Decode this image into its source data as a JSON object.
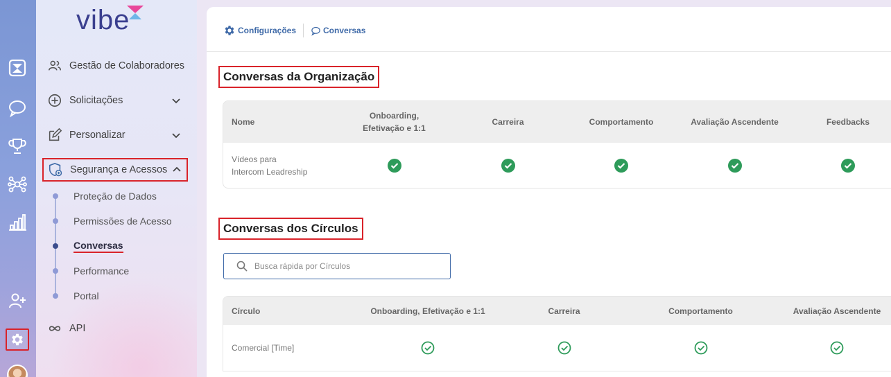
{
  "brand": {
    "logo_text": "vibe",
    "accent": "#e8479a"
  },
  "sidebar": {
    "items": [
      {
        "label": "Gestão de Colaboradores",
        "icon": "users-icon"
      },
      {
        "label": "Solicitações",
        "icon": "plus-circle-icon"
      },
      {
        "label": "Personalizar",
        "icon": "edit-icon"
      },
      {
        "label": "Segurança e Acessos",
        "icon": "shield-icon"
      },
      {
        "label": "API",
        "icon": "infinity-icon"
      }
    ],
    "subitems": [
      {
        "label": "Proteção de Dados"
      },
      {
        "label": "Permissões de Acesso"
      },
      {
        "label": "Conversas"
      },
      {
        "label": "Performance"
      },
      {
        "label": "Portal"
      }
    ]
  },
  "breadcrumb": {
    "item1": "Configurações",
    "item2": "Conversas"
  },
  "org_section": {
    "title": "Conversas da Organização",
    "headers": [
      "Nome",
      "Onboarding, Efetivação e 1:1",
      "Carreira",
      "Comportamento",
      "Avaliação Ascendente",
      "Feedbacks"
    ],
    "row": {
      "name": "Vídeos para Intercom Leadreship",
      "checks": [
        true,
        true,
        true,
        true,
        true
      ]
    }
  },
  "circles_section": {
    "title": "Conversas dos Círculos",
    "search_placeholder": "Busca rápida por Círculos",
    "headers": [
      "Círculo",
      "Onboarding, Efetivação e 1:1",
      "Carreira",
      "Comportamento",
      "Avaliação Ascendente"
    ],
    "row": {
      "name": "Comercial [Time]",
      "checks": [
        true,
        true,
        true,
        true
      ]
    }
  },
  "colors": {
    "check_green": "#2e9b5a",
    "highlight_red": "#d9232a",
    "link_blue": "#3f6aa8"
  }
}
